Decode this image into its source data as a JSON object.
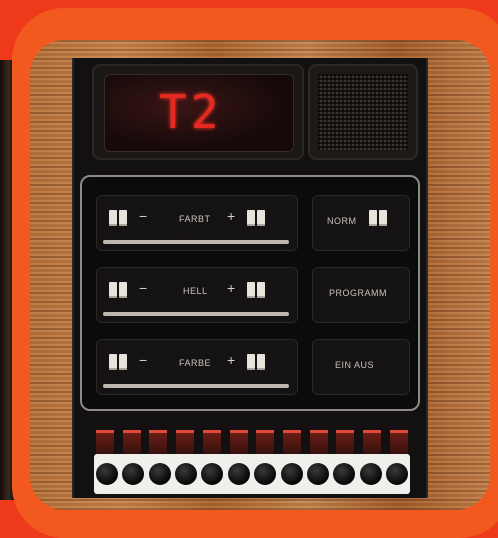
{
  "display": {
    "digits": "T2"
  },
  "controls": {
    "row1": {
      "minus": "−",
      "label": "FARBT",
      "plus": "+",
      "indicator": "·"
    },
    "row2": {
      "minus": "−",
      "label": "HELL",
      "plus": "+"
    },
    "row3": {
      "minus": "−",
      "label": "FARBE",
      "plus": "+"
    },
    "norm": {
      "label": "NORM"
    },
    "programm": {
      "label": "PROGRAMM"
    },
    "power": {
      "label": "EIN AUS"
    }
  },
  "keyboard": {
    "button_count": 12
  },
  "colors": {
    "background": "#ee3a1a",
    "frame": "#f2591e",
    "digit": "#e62a22",
    "panel": "#121010"
  }
}
